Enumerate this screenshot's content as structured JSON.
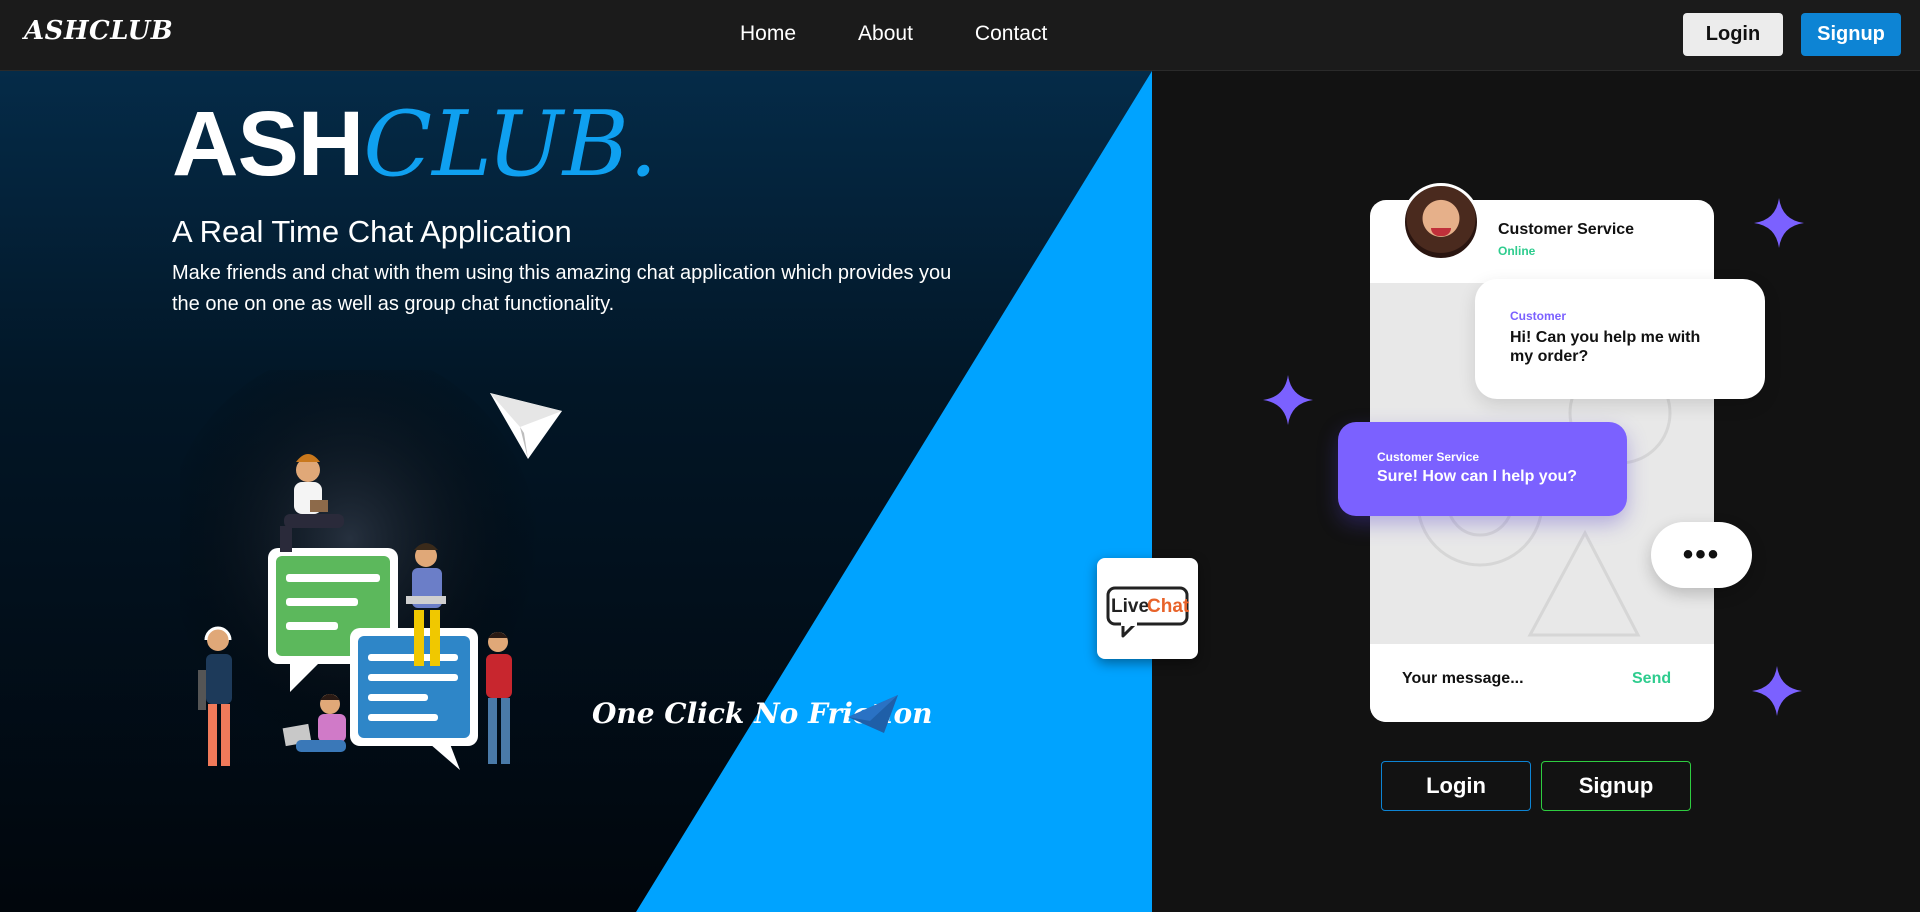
{
  "nav": {
    "brand": "ASHCLUB",
    "links": [
      "Home",
      "About",
      "Contact"
    ],
    "login_label": "Login",
    "signup_label": "Signup"
  },
  "hero": {
    "title_part1": "ASH",
    "title_part2": "CLUB.",
    "subtitle": "A Real Time Chat Application",
    "description": "Make friends and chat with them using this amazing chat application which provides you the one on one as well as group chat functionality.",
    "tagline": "One Click No Friction"
  },
  "chat": {
    "agent_name": "Customer Service",
    "agent_status": "Online",
    "message1_sender": "Customer",
    "message1_text": "Hi! Can you help me with my order?",
    "message2_sender": "Customer Service",
    "message2_text": "Sure! How can I help you?",
    "typing_indicator": "•••",
    "input_placeholder": "Your message...",
    "send_label": "Send"
  },
  "livechat": {
    "logo_part1": "Live",
    "logo_part2": "Chat"
  },
  "actions": {
    "login_label": "Login",
    "signup_label": "Signup"
  },
  "colors": {
    "accent_blue": "#00a3ff",
    "brand_blue": "#0d84d4",
    "purple": "#7b61ff",
    "green": "#2ecc8e",
    "dark": "#121212"
  }
}
